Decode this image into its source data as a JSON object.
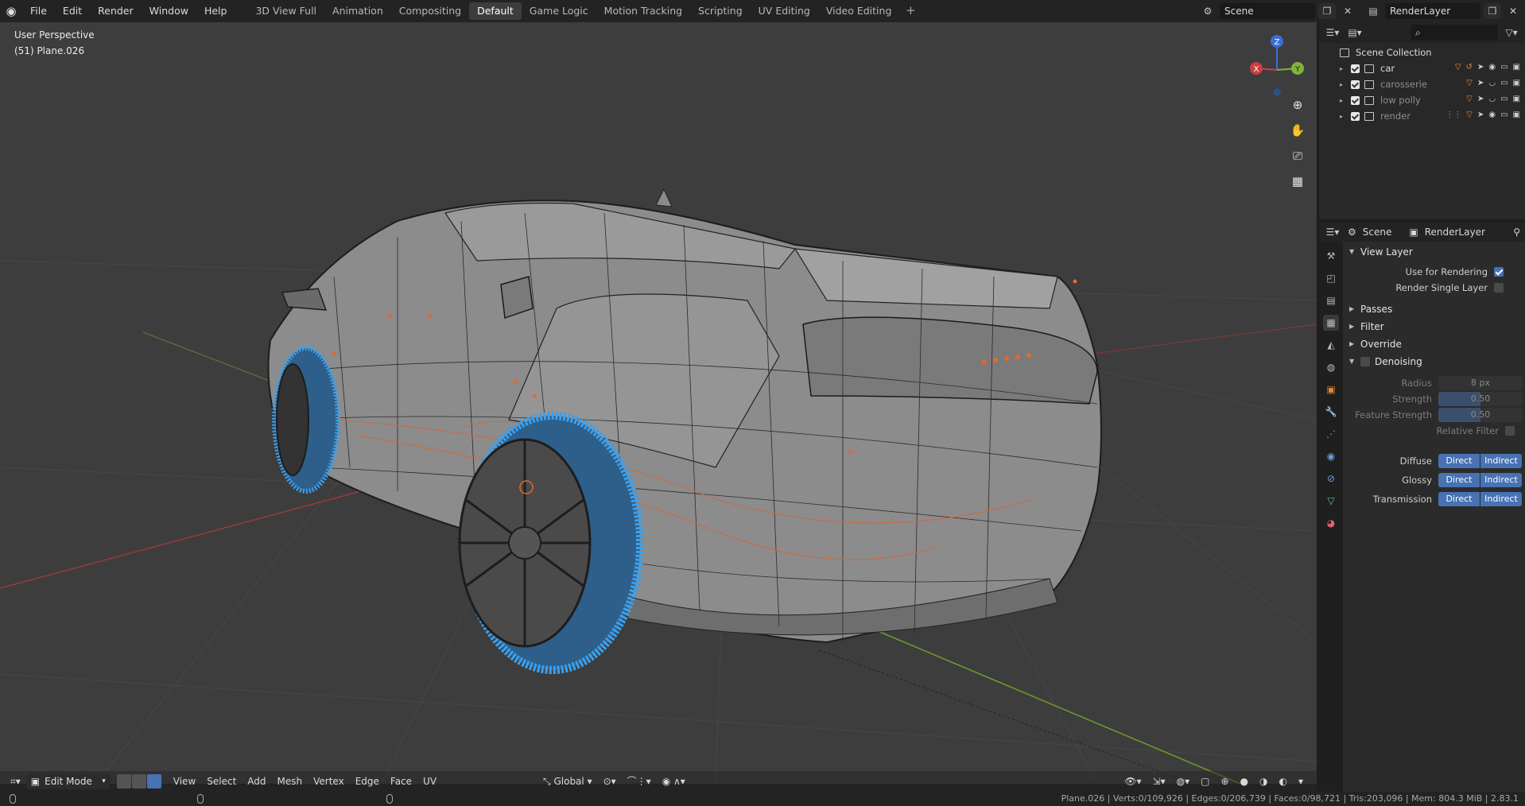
{
  "menu": [
    "File",
    "Edit",
    "Render",
    "Window",
    "Help"
  ],
  "workspaces": [
    {
      "label": "3D View Full",
      "active": false
    },
    {
      "label": "Animation",
      "active": false
    },
    {
      "label": "Compositing",
      "active": false
    },
    {
      "label": "Default",
      "active": true
    },
    {
      "label": "Game Logic",
      "active": false
    },
    {
      "label": "Motion Tracking",
      "active": false
    },
    {
      "label": "Scripting",
      "active": false
    },
    {
      "label": "UV Editing",
      "active": false
    },
    {
      "label": "Video Editing",
      "active": false
    }
  ],
  "scene": {
    "name": "Scene",
    "view_layer": "RenderLayer"
  },
  "viewport": {
    "perspective": "User Perspective",
    "object": "(51) Plane.026",
    "gizmo": {
      "x": "X",
      "y": "Y",
      "z": "Z"
    }
  },
  "header": {
    "mode": "Edit Mode",
    "menus": [
      "View",
      "Select",
      "Add",
      "Mesh",
      "Vertex",
      "Edge",
      "Face",
      "UV"
    ],
    "orientation": "Global"
  },
  "outliner": {
    "root": "Scene Collection",
    "collections": [
      {
        "name": "car",
        "muted": false
      },
      {
        "name": "carosserie",
        "muted": true
      },
      {
        "name": "low polly",
        "muted": true
      },
      {
        "name": "render",
        "muted": true
      }
    ]
  },
  "properties": {
    "header_scene": "Scene",
    "header_layer": "RenderLayer",
    "view_layer_title": "View Layer",
    "use_for_rendering": "Use for Rendering",
    "render_single_layer": "Render Single Layer",
    "panels": [
      "Passes",
      "Filter",
      "Override"
    ],
    "denoising": {
      "title": "Denoising",
      "radius_label": "Radius",
      "radius": "8 px",
      "strength_label": "Strength",
      "strength": "0.50",
      "feature_strength_label": "Feature Strength",
      "feature_strength": "0.50",
      "relative_filter": "Relative Filter"
    },
    "light_rows": [
      {
        "label": "Diffuse",
        "a": "Direct",
        "b": "Indirect"
      },
      {
        "label": "Glossy",
        "a": "Direct",
        "b": "Indirect"
      },
      {
        "label": "Transmission",
        "a": "Direct",
        "b": "Indirect"
      }
    ]
  },
  "status": "Plane.026 | Verts:0/109,926 | Edges:0/206,739 | Faces:0/98,721 | Tris:203,096 | Mem: 804.3 MiB | 2.83.1"
}
